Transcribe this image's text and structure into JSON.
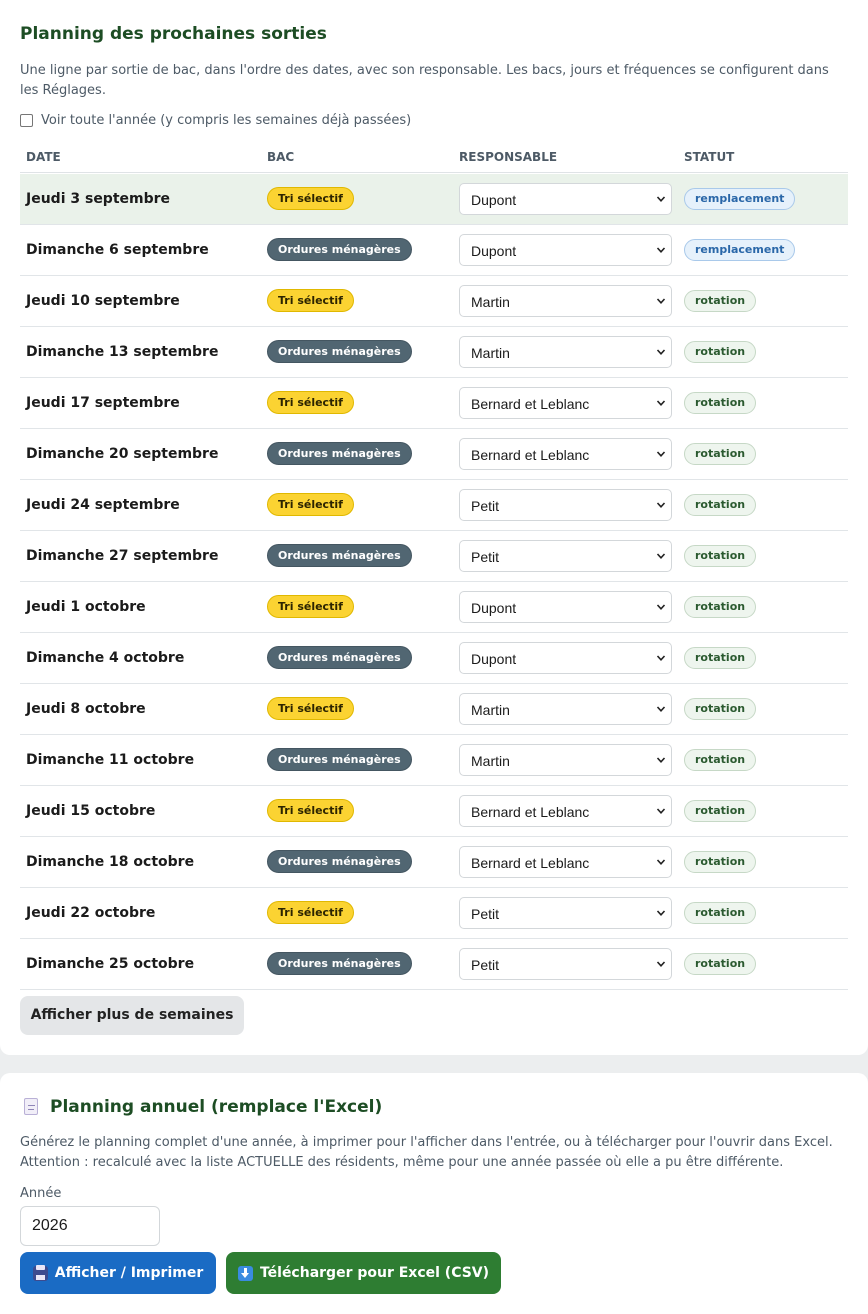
{
  "planning": {
    "title": "Planning des prochaines sorties",
    "description": "Une ligne par sortie de bac, dans l'ordre des dates, avec son responsable. Les bacs, jours et fréquences se configurent dans les Réglages.",
    "show_all_label": "Voir toute l'année (y compris les semaines déjà passées)",
    "show_all_checked": false,
    "columns": [
      "DATE",
      "BAC",
      "RESPONSABLE",
      "STATUT"
    ],
    "rows": [
      {
        "date": "Jeudi 3 septembre",
        "bac": "Tri sélectif",
        "bac_kind": "tri",
        "responsable": "Dupont",
        "statut": "remplacement"
      },
      {
        "date": "Dimanche 6 septembre",
        "bac": "Ordures ménagères",
        "bac_kind": "om",
        "responsable": "Dupont",
        "statut": "remplacement"
      },
      {
        "date": "Jeudi 10 septembre",
        "bac": "Tri sélectif",
        "bac_kind": "tri",
        "responsable": "Martin",
        "statut": "rotation"
      },
      {
        "date": "Dimanche 13 septembre",
        "bac": "Ordures ménagères",
        "bac_kind": "om",
        "responsable": "Martin",
        "statut": "rotation"
      },
      {
        "date": "Jeudi 17 septembre",
        "bac": "Tri sélectif",
        "bac_kind": "tri",
        "responsable": "Bernard et Leblanc",
        "statut": "rotation"
      },
      {
        "date": "Dimanche 20 septembre",
        "bac": "Ordures ménagères",
        "bac_kind": "om",
        "responsable": "Bernard et Leblanc",
        "statut": "rotation"
      },
      {
        "date": "Jeudi 24 septembre",
        "bac": "Tri sélectif",
        "bac_kind": "tri",
        "responsable": "Petit",
        "statut": "rotation"
      },
      {
        "date": "Dimanche 27 septembre",
        "bac": "Ordures ménagères",
        "bac_kind": "om",
        "responsable": "Petit",
        "statut": "rotation"
      },
      {
        "date": "Jeudi 1 octobre",
        "bac": "Tri sélectif",
        "bac_kind": "tri",
        "responsable": "Dupont",
        "statut": "rotation"
      },
      {
        "date": "Dimanche 4 octobre",
        "bac": "Ordures ménagères",
        "bac_kind": "om",
        "responsable": "Dupont",
        "statut": "rotation"
      },
      {
        "date": "Jeudi 8 octobre",
        "bac": "Tri sélectif",
        "bac_kind": "tri",
        "responsable": "Martin",
        "statut": "rotation"
      },
      {
        "date": "Dimanche 11 octobre",
        "bac": "Ordures ménagères",
        "bac_kind": "om",
        "responsable": "Martin",
        "statut": "rotation"
      },
      {
        "date": "Jeudi 15 octobre",
        "bac": "Tri sélectif",
        "bac_kind": "tri",
        "responsable": "Bernard et Leblanc",
        "statut": "rotation"
      },
      {
        "date": "Dimanche 18 octobre",
        "bac": "Ordures ménagères",
        "bac_kind": "om",
        "responsable": "Bernard et Leblanc",
        "statut": "rotation"
      },
      {
        "date": "Jeudi 22 octobre",
        "bac": "Tri sélectif",
        "bac_kind": "tri",
        "responsable": "Petit",
        "statut": "rotation"
      },
      {
        "date": "Dimanche 25 octobre",
        "bac": "Ordures ménagères",
        "bac_kind": "om",
        "responsable": "Petit",
        "statut": "rotation"
      }
    ],
    "show_more_label": "Afficher plus de semaines"
  },
  "annual": {
    "icon": "document-icon",
    "title": "Planning annuel (remplace l'Excel)",
    "description_line1": "Générez le planning complet d'une année, à imprimer pour l'afficher dans l'entrée, ou à télécharger pour l'ouvrir dans Excel.",
    "description_line2": "Attention : recalculé avec la liste ACTUELLE des résidents, même pour une année passée où elle a pu être différente.",
    "year_label": "Année",
    "year_value": "2026",
    "print_label": "Afficher / Imprimer",
    "print_icon": "printer-icon",
    "csv_label": "Télécharger pour Excel (CSV)",
    "csv_icon": "download-icon"
  },
  "colors": {
    "heading": "#1d4d24",
    "tri_pill": "#fbd332",
    "om_pill": "#516672",
    "print_button": "#1a6bc4",
    "csv_button": "#2e7d32",
    "highlight_row": "#eaf2ea"
  }
}
